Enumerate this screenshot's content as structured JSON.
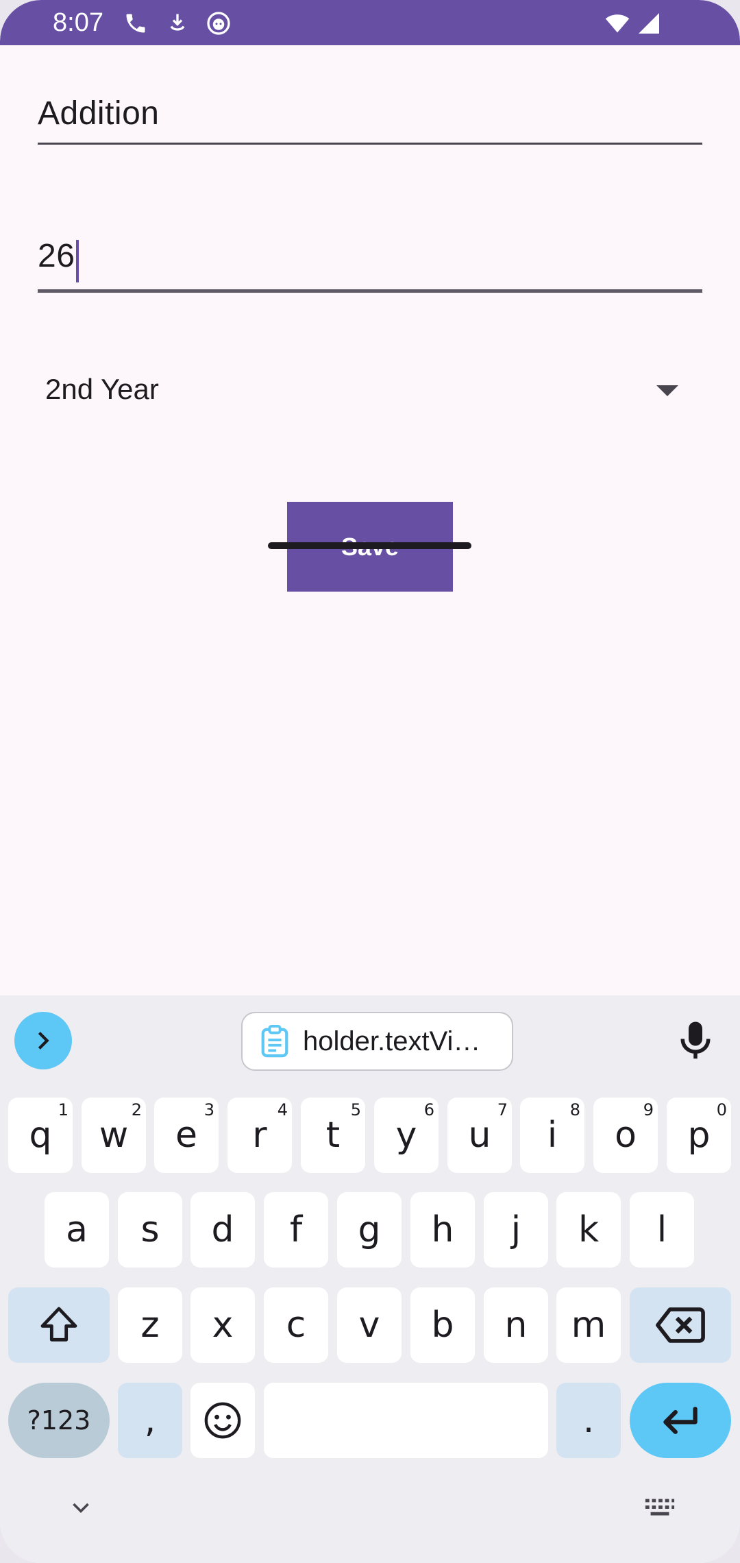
{
  "status_bar": {
    "time": "8:07",
    "icons": [
      "phone-icon",
      "download-icon",
      "cat-face-icon",
      "wifi-icon",
      "signal-icon"
    ],
    "color": "#6750a4"
  },
  "form": {
    "name_field": {
      "value": "Addition"
    },
    "number_field": {
      "value": "26"
    },
    "year_spinner": {
      "selected": "2nd Year"
    },
    "save_button": {
      "label": "Save"
    }
  },
  "keyboard": {
    "clipboard_suggestion": "holder.textVi…",
    "row1": [
      {
        "key": "q",
        "hint": "1"
      },
      {
        "key": "w",
        "hint": "2"
      },
      {
        "key": "e",
        "hint": "3"
      },
      {
        "key": "r",
        "hint": "4"
      },
      {
        "key": "t",
        "hint": "5"
      },
      {
        "key": "y",
        "hint": "6"
      },
      {
        "key": "u",
        "hint": "7"
      },
      {
        "key": "i",
        "hint": "8"
      },
      {
        "key": "o",
        "hint": "9"
      },
      {
        "key": "p",
        "hint": "0"
      }
    ],
    "row2": [
      "a",
      "s",
      "d",
      "f",
      "g",
      "h",
      "j",
      "k",
      "l"
    ],
    "row3": [
      "z",
      "x",
      "c",
      "v",
      "b",
      "n",
      "m"
    ],
    "symbols_label": "?123",
    "comma_label": ",",
    "period_label": ".",
    "accent_color": "#5dc7f5"
  }
}
